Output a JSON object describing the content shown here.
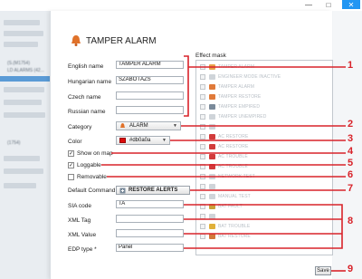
{
  "window": {
    "minimize_icon": "minimize-icon",
    "maximize_icon": "maximize-icon",
    "close_icon": "close-icon",
    "controls": [
      "—",
      "□",
      "✕"
    ]
  },
  "background_list": {
    "row_texts": [
      "(S.(M1754)",
      "LD ALARMS (42...",
      "(1754)"
    ]
  },
  "dialog": {
    "title": "TAMPER ALARM",
    "fields": {
      "english_name_label": "English name",
      "english_name_value": "TAMPER ALARM",
      "hungarian_name_label": "Hungarian name",
      "hungarian_name_value": "SZABOTÁZS",
      "czech_name_label": "Czech name",
      "czech_name_value": "",
      "russian_name_label": "Russian name",
      "russian_name_value": "",
      "category_label": "Category",
      "category_value": "ALARM",
      "color_label": "Color",
      "color_value": "#db0a0a",
      "show_on_map_label": "Show on map",
      "show_on_map_checked": true,
      "loggable_label": "Loggable",
      "loggable_checked": true,
      "removable_label": "Removable",
      "removable_checked": false,
      "default_command_label": "Default Command",
      "default_command_value": "RESTORE ALERTS",
      "sia_code_label": "SIA code",
      "sia_code_value": "TA",
      "xml_tag_label": "XML Tag",
      "xml_tag_value": "",
      "xml_value_label": "XML Value",
      "xml_value_value": "",
      "edp_type_label": "EDP type *",
      "edp_type_value": "Panel"
    },
    "effect_mask": {
      "label": "Effect mask",
      "items": [
        "TAMPER ALARM",
        "ENGINEER MODE INACTIVE",
        "TAMPER ALARM",
        "TAMPER RESTORE",
        "TAMPER EMPIRED",
        "TAMPER UNEMPIRED",
        "",
        "AC RESTORE",
        "AC RESTORE",
        "AC TROUBLE",
        "AC TROUBLE",
        "NETWORK TEST",
        "",
        "MANUAL TEST",
        "BAT FAULT",
        "",
        "BAT TROUBLE",
        "BAT RESTORE"
      ],
      "item_colors": [
        "#e8a24a",
        "#cfd4d9",
        "#e07a3a",
        "#e07a3a",
        "#7a8a9a",
        "#cfd4d9",
        "#cfd4d9",
        "#d23b3b",
        "#d23b3b",
        "#d23b3b",
        "#d23b3b",
        "#cfd4d9",
        "#cfd4d9",
        "#cfd4d9",
        "#c8a23a",
        "#cfd4d9",
        "#e0b03a",
        "#d2783a"
      ]
    },
    "save_label": "Save"
  },
  "callouts": [
    "1",
    "2",
    "3",
    "4",
    "5",
    "6",
    "7",
    "8",
    "9"
  ],
  "colors": {
    "accent_blue": "#2196f3",
    "callout_red": "#d8232a",
    "alarm_red": "#db0a0a"
  }
}
